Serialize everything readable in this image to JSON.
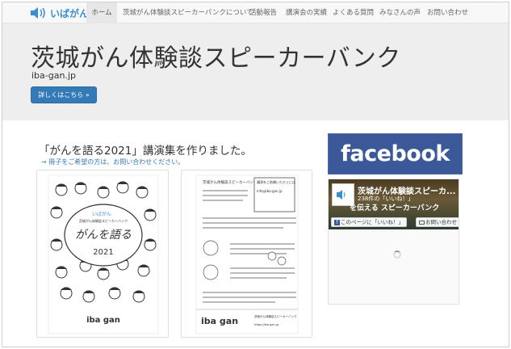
{
  "brand": {
    "text": "いばがん",
    "color": "#3a8fd3"
  },
  "nav": {
    "items": [
      {
        "label": "ホーム",
        "active": true
      },
      {
        "label": "茨城がん体験談スピーカーバンクについて"
      },
      {
        "label": "活動報告"
      },
      {
        "label": "講演会の実績"
      },
      {
        "label": "よくある質問"
      },
      {
        "label": "みなさんの声"
      },
      {
        "label": "お問い合わせ"
      }
    ]
  },
  "jumbotron": {
    "title": "茨城がん体験談スピーカーバンク",
    "domain": "iba-gan.jp",
    "button_label": "詳しくはこちら »"
  },
  "content": {
    "headline": "「がんを語る2021」講演集を作りました。",
    "order_link": "→ 冊子をご希望の方は、お問い合わせください。",
    "booklet_cover": {
      "brand": "いばがん",
      "org": "茨城がん体験談スピーカーバンク",
      "title": "がんを語る",
      "year": "2021",
      "logo": "iba gan"
    },
    "booklet_back": {
      "header": "茨城がん体験談スピーカーバンク",
      "box_title": "講演をご依頼いただくには",
      "email": "info@iba-gan.jp",
      "logo": "iba gan",
      "org": "茨城がん体験談スピーカーバンク",
      "site": "https://iba-gan.jp"
    }
  },
  "facebook": {
    "banner_text": "facebook",
    "banner_color": "#3b5998",
    "page_name": "茨城がん体験談スピーカ...",
    "likes": "238件の「いいね！」",
    "cover_text": "を伝える スピーカーバンク",
    "like_button": "このページに「いいね！」",
    "contact_button": "お問い合わせ"
  }
}
